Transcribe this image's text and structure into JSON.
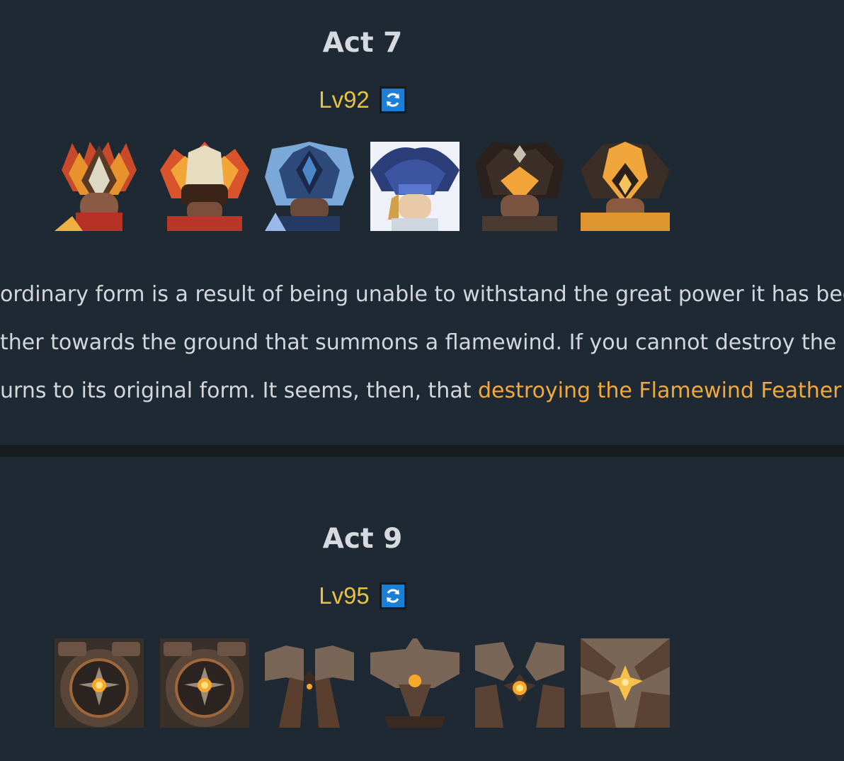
{
  "acts": [
    {
      "title": "Act 7",
      "level": "Lv92",
      "enemies": [
        {
          "icon": "flame-masked-warrior-icon"
        },
        {
          "icon": "flame-masked-warrior-2-icon"
        },
        {
          "icon": "hydro-masked-warrior-icon"
        },
        {
          "icon": "hydro-hat-warrior-icon"
        },
        {
          "icon": "geo-masked-warrior-icon"
        },
        {
          "icon": "geo-masked-warrior-2-icon"
        }
      ],
      "description": {
        "line1": "ordinary form is a result of being unable to withstand the great power it has been",
        "line2": "ther towards the ground that summons a flamewind. If you cannot destroy the F",
        "line3_prefix": "urns to its original form. It seems, then, that ",
        "line3_highlight": "destroying the Flamewind Feather u"
      }
    },
    {
      "title": "Act 9",
      "level": "Lv95",
      "enemies": [
        {
          "icon": "construct-core-icon"
        },
        {
          "icon": "construct-core-2-icon"
        },
        {
          "icon": "construct-legs-icon"
        },
        {
          "icon": "construct-winged-icon"
        },
        {
          "icon": "construct-claw-icon"
        },
        {
          "icon": "construct-star-icon"
        }
      ]
    }
  ],
  "colors": {
    "background": "#1f2933",
    "level": "#e8c33a",
    "highlight": "#f0a93b",
    "refresh": "#1a7fd6"
  },
  "icons": {
    "refresh": "refresh-icon"
  }
}
